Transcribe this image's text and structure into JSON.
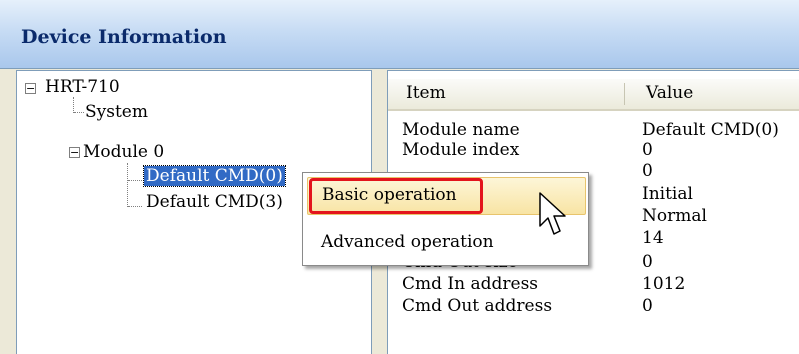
{
  "window": {
    "title": "Device Information"
  },
  "tree": {
    "root": {
      "label": "HRT-710"
    },
    "system": {
      "label": "System"
    },
    "module": {
      "label": "Module 0"
    },
    "cmd0": {
      "label": "Default CMD(0)"
    },
    "cmd3": {
      "label": "Default CMD(3)"
    }
  },
  "list": {
    "columns": {
      "item": "Item",
      "value": "Value"
    },
    "rows": [
      {
        "item": "Module name",
        "value": "Default CMD(0)"
      },
      {
        "item": "Module index",
        "value": "0"
      },
      {
        "item": "",
        "value": "0"
      },
      {
        "item": "",
        "value": "Initial"
      },
      {
        "item": "",
        "value": "Normal"
      },
      {
        "item": "",
        "value": "14"
      },
      {
        "item": "Cmd Out size",
        "value": "0"
      },
      {
        "item": "Cmd In address",
        "value": "1012"
      },
      {
        "item": "Cmd Out address",
        "value": "0"
      }
    ]
  },
  "context_menu": {
    "basic": "Basic operation",
    "advanced": "Advanced operation"
  },
  "colors": {
    "selection": "#316ac5",
    "highlight_ring": "#e3141c",
    "menu_hover": "#f8e4a4"
  }
}
